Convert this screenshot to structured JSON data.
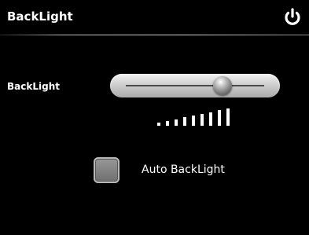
{
  "header": {
    "title": "BackLight",
    "power_icon": "power-icon"
  },
  "backlight_row": {
    "label": "BackLight",
    "slider_level": 0.7
  },
  "level_indicator": {
    "total_steps": 9,
    "icon": "signal-level-icon"
  },
  "auto_backlight": {
    "label": "Auto BackLight",
    "checked": false
  },
  "colors": {
    "background": "#000000",
    "text": "#ffffff",
    "slider": "#cfcfcf",
    "checkbox": "#808080"
  }
}
